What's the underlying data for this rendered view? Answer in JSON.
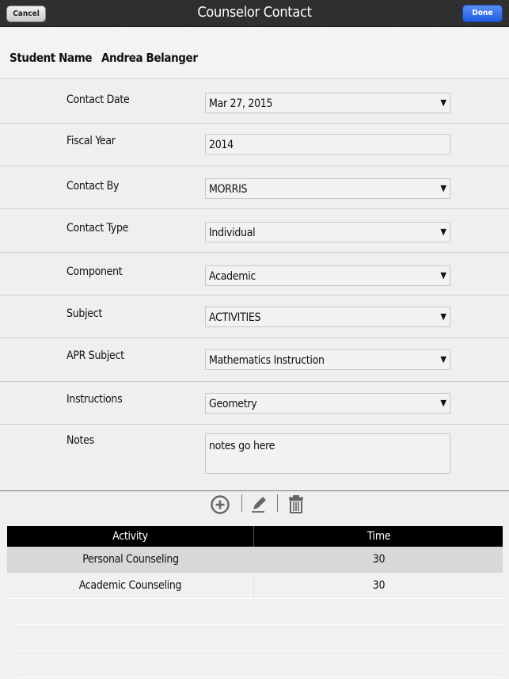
{
  "navbar": {
    "title": "Counselor Contact",
    "cancel_label": "Cancel",
    "done_label": "Done"
  },
  "student": {
    "label": "Student Name",
    "value": "Andrea Belanger"
  },
  "form": {
    "contact_date": {
      "label": "Contact Date",
      "value": "Mar 27, 2015"
    },
    "fiscal_year": {
      "label": "Fiscal Year",
      "value": "2014"
    },
    "contact_by": {
      "label": "Contact By",
      "value": "MORRIS"
    },
    "contact_type": {
      "label": "Contact Type",
      "value": "Individual"
    },
    "component": {
      "label": "Component",
      "value": "Academic"
    },
    "subject": {
      "label": "Subject",
      "value": "ACTIVITIES"
    },
    "apr_subject": {
      "label": "APR Subject",
      "value": "Mathematics Instruction"
    },
    "instructions": {
      "label": "Instructions",
      "value": "Geometry"
    },
    "notes": {
      "label": "Notes",
      "value": "notes go here"
    },
    "dropdown_arrow": "▼"
  },
  "toolbar": {
    "icons": [
      "add-circle-icon",
      "edit-pencil-icon",
      "trash-icon"
    ]
  },
  "table": {
    "headers": [
      "Activity",
      "Time"
    ],
    "rows": [
      {
        "activity": "Personal Counseling",
        "time": "30"
      },
      {
        "activity": "Academic Counseling",
        "time": "30"
      }
    ]
  }
}
